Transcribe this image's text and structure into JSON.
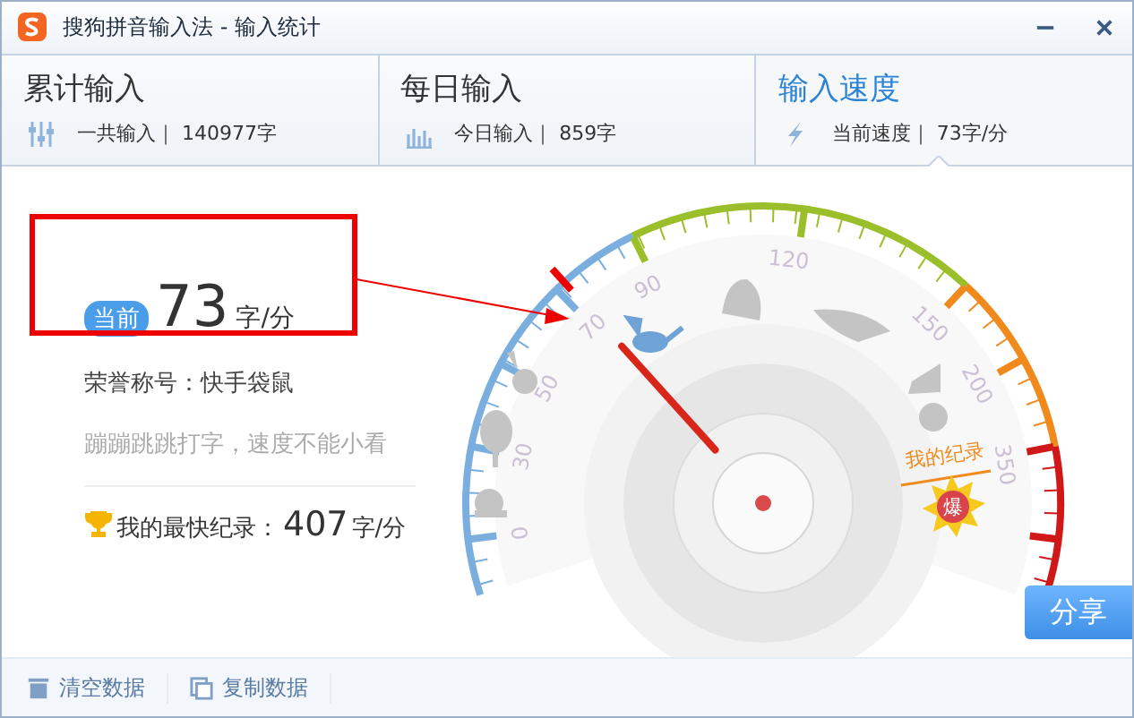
{
  "window": {
    "title": "搜狗拼音输入法 - 输入统计"
  },
  "tabs": [
    {
      "title": "累计输入",
      "kind": "sliders",
      "label": "一共输入｜",
      "value": "140977字",
      "selected": false
    },
    {
      "title": "每日输入",
      "kind": "bars",
      "label": "今日输入｜",
      "value": "859字",
      "selected": false
    },
    {
      "title": "输入速度",
      "kind": "bolt",
      "label": "当前速度｜",
      "value": "73字/分",
      "selected": true
    }
  ],
  "current": {
    "badge": "当前",
    "value": "73",
    "unit": "字/分"
  },
  "honor": "荣誉称号：快手袋鼠",
  "slogan": "蹦蹦跳跳打字，速度不能小看",
  "record": {
    "label": "我的最快纪录：",
    "value": "407",
    "unit": "字/分"
  },
  "gauge": {
    "tick_labels": [
      "0",
      "30",
      "50",
      "70",
      "90",
      "120",
      "150",
      "200",
      "350"
    ],
    "level": 0.3,
    "record_label": "我的纪录",
    "record_badge": "爆"
  },
  "share_button": "分享",
  "footer": [
    {
      "label": "清空数据",
      "kind": "trash"
    },
    {
      "label": "复制数据",
      "kind": "copy"
    }
  ]
}
